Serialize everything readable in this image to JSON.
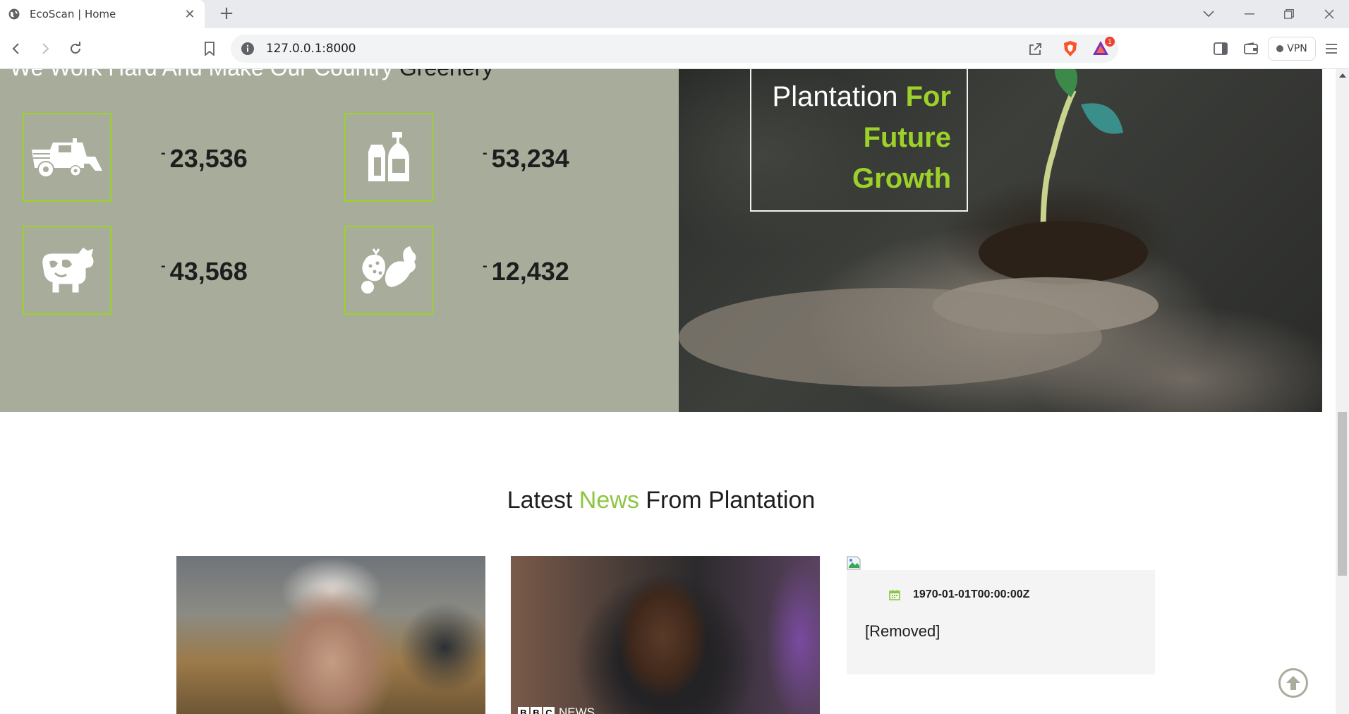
{
  "browser": {
    "tab_title": "EcoScan | Home",
    "url": "127.0.0.1:8000",
    "vpn_label": "VPN",
    "alert_badge": "1"
  },
  "stats": {
    "heading_light": "We Work Hard And Make Our Country",
    "heading_dark": "Greenery",
    "items": [
      {
        "icon": "harvester-icon",
        "dash": "-",
        "value": "23,536"
      },
      {
        "icon": "milk-bottles-icon",
        "dash": "-",
        "value": "53,234"
      },
      {
        "icon": "cow-icon",
        "dash": "-",
        "value": "43,568"
      },
      {
        "icon": "fruits-vegetables-icon",
        "dash": "-",
        "value": "12,432"
      }
    ]
  },
  "hero": {
    "line1_plain": "Plantation ",
    "line1_green": "For",
    "line2": "Future",
    "line3": "Growth"
  },
  "news": {
    "title_a": "Latest ",
    "title_green": "News",
    "title_b": " From Plantation",
    "card2_brand_letters": [
      "B",
      "B",
      "C"
    ],
    "card2_brand_word": "NEWS",
    "card3_date": "1970-01-01T00:00:00Z",
    "card3_text": "[Removed]"
  },
  "colors": {
    "accent_green": "#9cd12a",
    "stats_bg": "#a8ad9b",
    "news_green": "#8cc63f"
  }
}
